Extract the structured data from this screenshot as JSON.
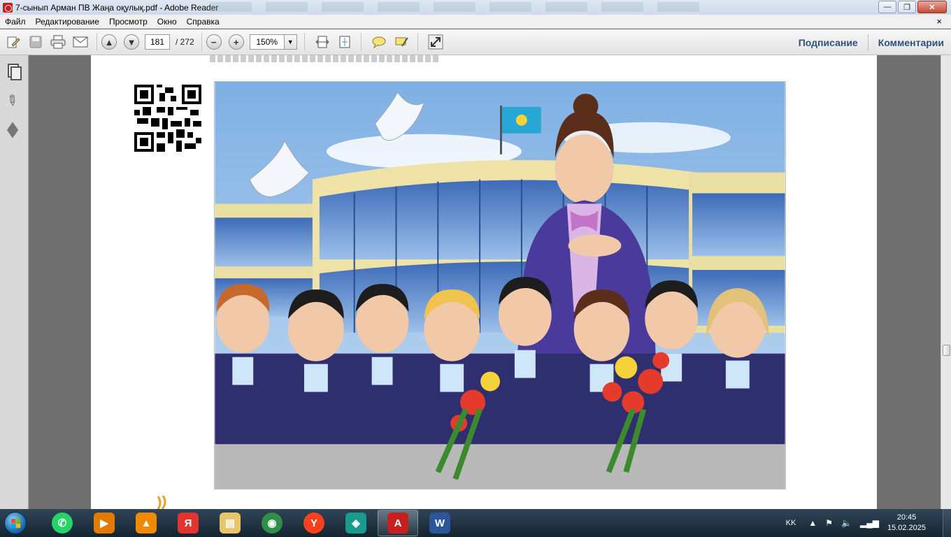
{
  "window": {
    "title": "7-сынып Арман ПВ Жаңа оқулық.pdf - Adobe Reader",
    "min_label": "▭",
    "restore_label": "❐",
    "close_label": "✕"
  },
  "menu": {
    "items": [
      "Файл",
      "Редактирование",
      "Просмотр",
      "Окно",
      "Справка"
    ],
    "close_glyph": "×"
  },
  "toolbar": {
    "current_page": "181",
    "page_separator": "/ 272",
    "zoom": "150%",
    "sign_label": "Подписание",
    "comments_label": "Комментарии"
  },
  "taskbar": {
    "apps": [
      {
        "name": "whatsapp",
        "glyph": "✆",
        "color": "#25d366"
      },
      {
        "name": "media-player",
        "glyph": "▶",
        "color": "#e57a00"
      },
      {
        "name": "vlc",
        "glyph": "▲",
        "color": "#f08a00"
      },
      {
        "name": "yandex-browser",
        "glyph": "Я",
        "color": "#e3342f"
      },
      {
        "name": "file-explorer",
        "glyph": "▤",
        "color": "#e8c46a"
      },
      {
        "name": "chrome",
        "glyph": "◉",
        "color": "#2f8f46"
      },
      {
        "name": "yandex",
        "glyph": "Y",
        "color": "#fc3f1d"
      },
      {
        "name": "app-green",
        "glyph": "◈",
        "color": "#1a9a8c"
      },
      {
        "name": "adobe-reader",
        "glyph": "A",
        "color": "#c51f1f"
      },
      {
        "name": "word",
        "glyph": "W",
        "color": "#2b579a"
      }
    ],
    "language": "KK",
    "time": "20:45",
    "date": "15.02.2025"
  },
  "colors": {
    "accent_link": "#30517a",
    "taskbar": "#1e3140",
    "sky": "#8fb8e6"
  }
}
